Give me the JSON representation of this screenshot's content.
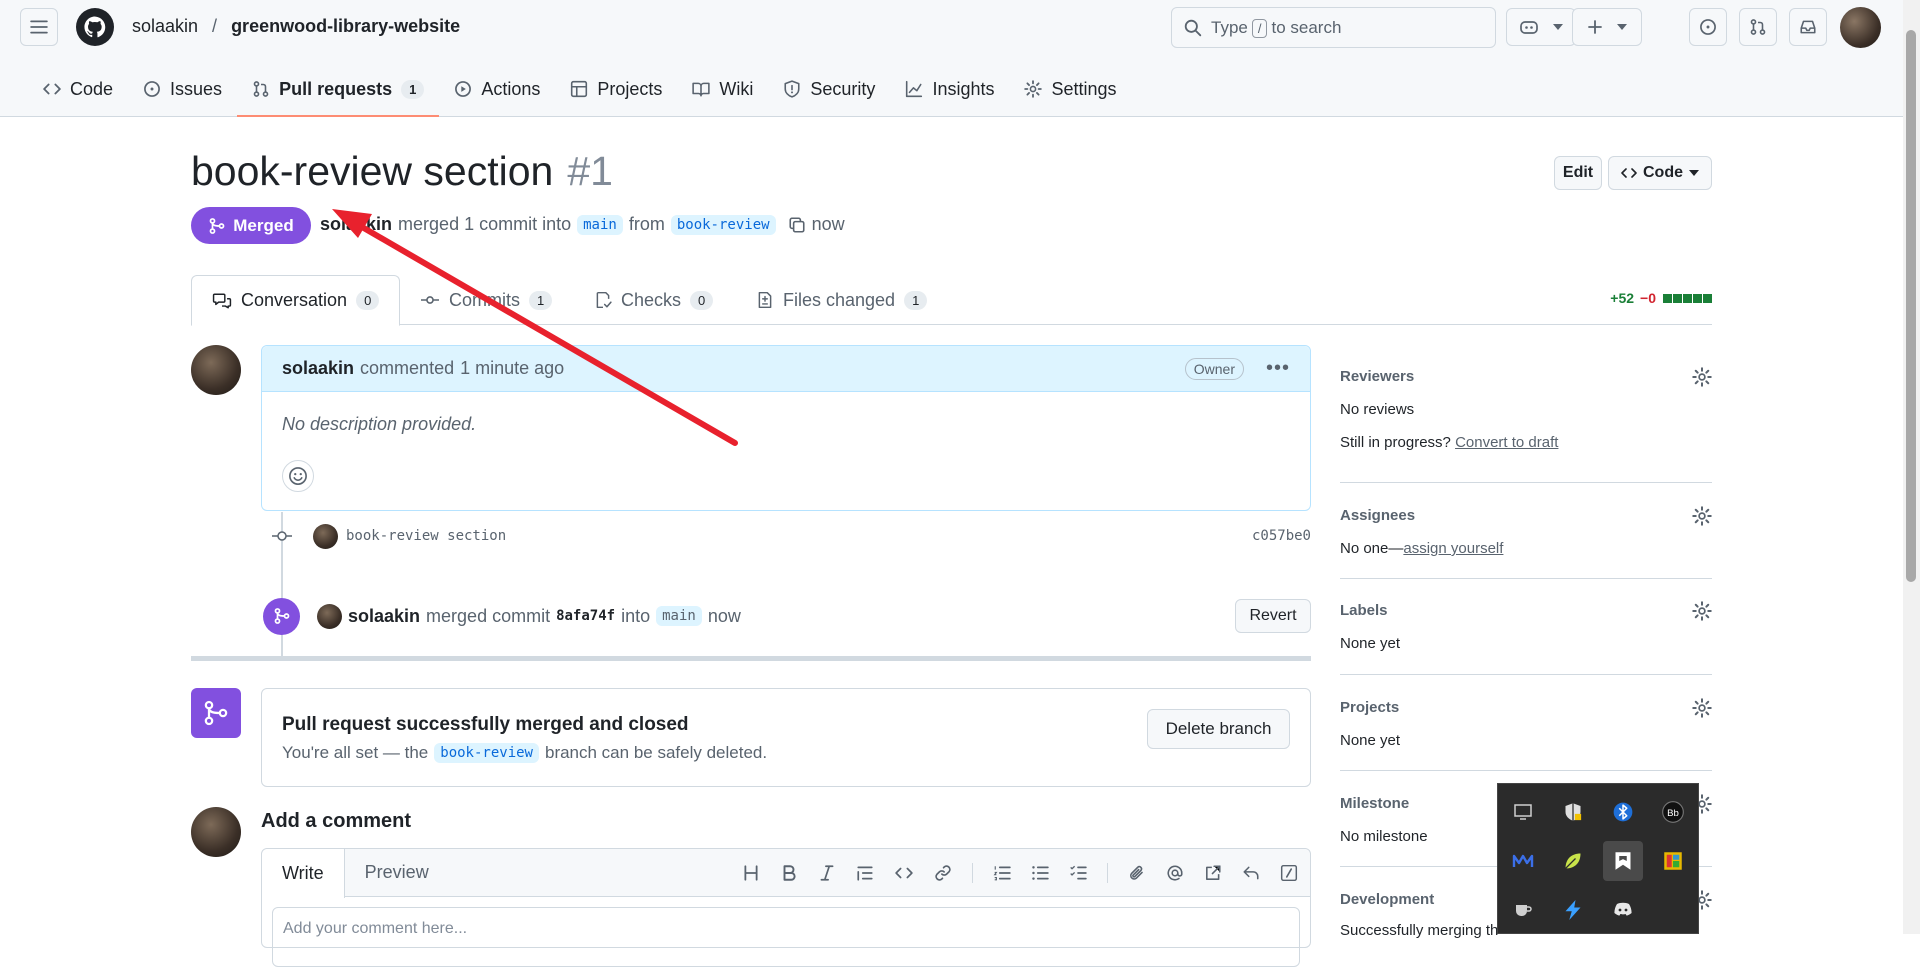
{
  "header": {
    "owner": "solaakin",
    "separator": "/",
    "repo": "greenwood-library-website",
    "search_before": "Type",
    "search_key": "/",
    "search_after": "to search"
  },
  "repo_tabs": [
    {
      "label": "Code"
    },
    {
      "label": "Issues"
    },
    {
      "label": "Pull requests",
      "count": "1"
    },
    {
      "label": "Actions"
    },
    {
      "label": "Projects"
    },
    {
      "label": "Wiki"
    },
    {
      "label": "Security"
    },
    {
      "label": "Insights"
    },
    {
      "label": "Settings"
    }
  ],
  "pr": {
    "title": "book-review section",
    "number": "#1",
    "edit_label": "Edit",
    "code_label": "Code",
    "state": "Merged",
    "author": "solaakin",
    "merged_text": "merged 1 commit into",
    "base_branch": "main",
    "from_text": "from",
    "head_branch": "book-review",
    "time": "now"
  },
  "pr_tabs": [
    {
      "label": "Conversation",
      "count": "0"
    },
    {
      "label": "Commits",
      "count": "1"
    },
    {
      "label": "Checks",
      "count": "0"
    },
    {
      "label": "Files changed",
      "count": "1"
    }
  ],
  "diffstat": {
    "additions": "+52",
    "deletions": "−0"
  },
  "comment": {
    "author": "solaakin",
    "action": "commented",
    "time": "1 minute ago",
    "role": "Owner",
    "body": "No description provided."
  },
  "commit": {
    "message": "book-review section",
    "sha": "c057be0"
  },
  "merge_event": {
    "author": "solaakin",
    "text": "merged commit",
    "sha": "8afa74f",
    "into": "into",
    "branch": "main",
    "time": "now",
    "revert_label": "Revert"
  },
  "merged_box": {
    "title": "Pull request successfully merged and closed",
    "line_before": "You're all set — the",
    "branch": "book-review",
    "line_after": "branch can be safely deleted.",
    "delete_label": "Delete branch"
  },
  "add_comment": {
    "title": "Add a comment",
    "write_tab": "Write",
    "preview_tab": "Preview",
    "placeholder": "Add your comment here..."
  },
  "sidebar": {
    "reviewers": {
      "title": "Reviewers",
      "value": "No reviews",
      "progress": "Still in progress?",
      "draft_link": "Convert to draft"
    },
    "assignees": {
      "title": "Assignees",
      "value": "No one—",
      "assign_link": "assign yourself"
    },
    "labels": {
      "title": "Labels",
      "value": "None yet"
    },
    "projects": {
      "title": "Projects",
      "value": "None yet"
    },
    "milestone": {
      "title": "Milestone",
      "value": "No milestone"
    },
    "development": {
      "title": "Development",
      "value": "Successfully merging th"
    }
  },
  "colors": {
    "accent_merged": "#8250df",
    "link": "#0969da",
    "arrow": "#e8212d",
    "tab_underline": "#fd8c73"
  }
}
